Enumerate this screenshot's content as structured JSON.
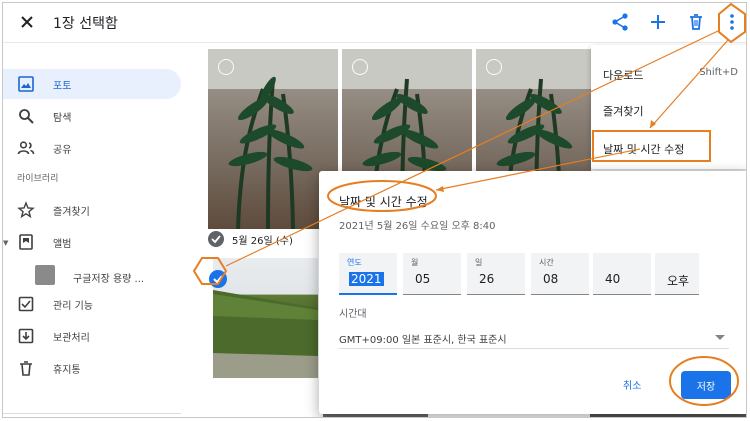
{
  "topbar": {
    "title": "1장 선택함",
    "icons": [
      "close-icon",
      "share-icon",
      "add-icon",
      "delete-icon",
      "more-vert-icon"
    ]
  },
  "sidebar": {
    "items": [
      {
        "label": "포토",
        "icon": "photo-icon",
        "active": true
      },
      {
        "label": "탐색",
        "icon": "search-icon"
      },
      {
        "label": "공유",
        "icon": "people-icon"
      }
    ],
    "section_label": "라이브러리",
    "library": [
      {
        "label": "즐겨찾기",
        "icon": "star-icon"
      },
      {
        "label": "앨범",
        "icon": "album-icon"
      },
      {
        "label": "구글저장 용량 ...",
        "icon": "album-thumb"
      },
      {
        "label": "관리 기능",
        "icon": "utilities-icon"
      },
      {
        "label": "보관처리",
        "icon": "archive-icon"
      },
      {
        "label": "휴지통",
        "icon": "trash-icon"
      }
    ]
  },
  "grid": {
    "date_label": "5월 26일 (수)"
  },
  "menu": {
    "items": [
      {
        "label": "다운로드",
        "shortcut": "Shift+D"
      },
      {
        "label": "즐겨찾기"
      },
      {
        "label": "날짜 및 시간 수정"
      }
    ]
  },
  "dialog": {
    "title": "날짜 및 시간 수정",
    "subtitle": "2021년 5월 26일 수요일 오후 8:40",
    "fields": [
      {
        "label": "연도",
        "value": "2021"
      },
      {
        "label": "월",
        "value": "05"
      },
      {
        "label": "일",
        "value": "26"
      },
      {
        "label": "시간",
        "value": "08"
      },
      {
        "label": "",
        "value": "40"
      },
      {
        "label": "",
        "value": "오후"
      }
    ],
    "timezone_label": "시간대",
    "timezone_value": "GMT+09:00 일본 표준시, 한국 표준시",
    "cancel_label": "취소",
    "save_label": "저장"
  },
  "colors": {
    "accent": "#1a73e8",
    "annotation": "#e67e22",
    "active_nav_bg": "#e8f0fe"
  }
}
